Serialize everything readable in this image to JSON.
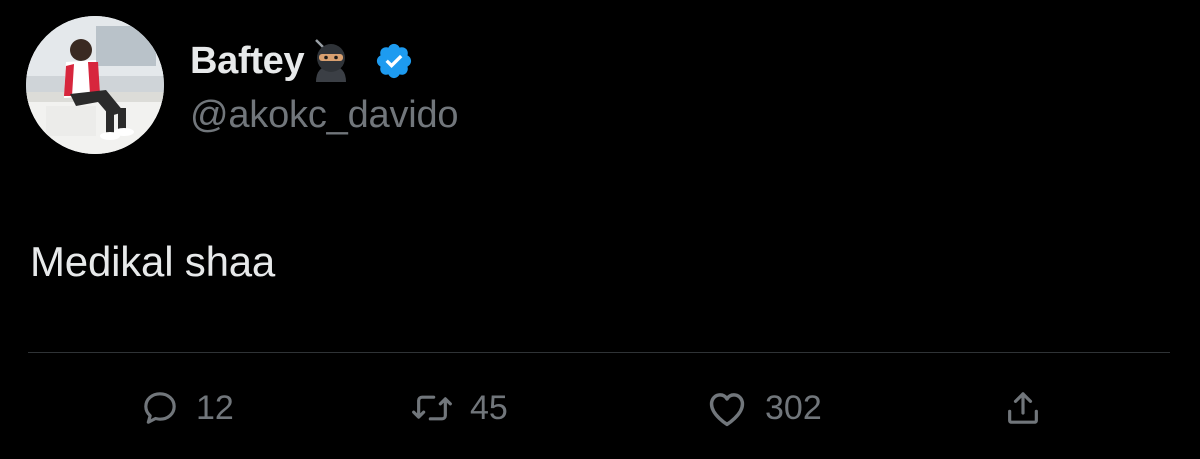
{
  "tweet": {
    "author": {
      "display_name": "Baftey",
      "handle": "@akokc_davido",
      "verified": true,
      "name_emoji": "ninja"
    },
    "text": "Medikal shaa",
    "stats": {
      "replies": "12",
      "retweets": "45",
      "likes": "302"
    }
  },
  "icons": {
    "reply": "speech-bubble-icon",
    "retweet": "retweet-arrows-icon",
    "like": "heart-icon",
    "share": "share-upload-icon",
    "verified": "verified-badge-icon"
  },
  "colors": {
    "background": "#000000",
    "primary_text": "#e7e9ea",
    "secondary_text": "#71767b",
    "verified_blue": "#1d9bf0",
    "divider": "#2f3336"
  }
}
